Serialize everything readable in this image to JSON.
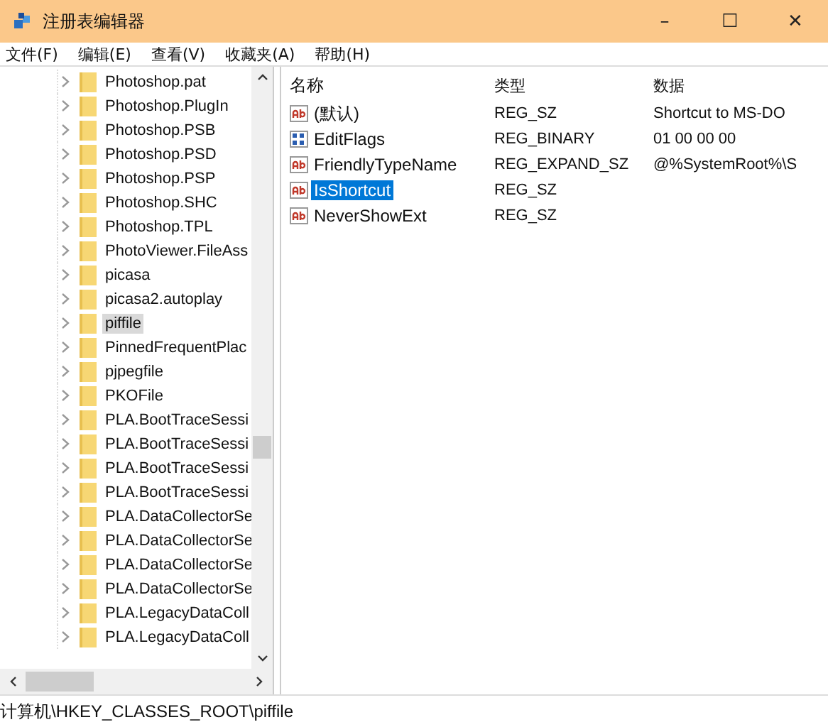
{
  "window": {
    "title": "注册表编辑器",
    "controls": [
      "–",
      "☐",
      "✕"
    ]
  },
  "menu": [
    "文件(F)",
    "编辑(E)",
    "查看(V)",
    "收藏夹(A)",
    "帮助(H)"
  ],
  "tree": [
    {
      "label": "Photoshop.pat",
      "selected": false
    },
    {
      "label": "Photoshop.PlugIn",
      "selected": false
    },
    {
      "label": "Photoshop.PSB",
      "selected": false
    },
    {
      "label": "Photoshop.PSD",
      "selected": false
    },
    {
      "label": "Photoshop.PSP",
      "selected": false
    },
    {
      "label": "Photoshop.SHC",
      "selected": false
    },
    {
      "label": "Photoshop.TPL",
      "selected": false
    },
    {
      "label": "PhotoViewer.FileAss",
      "selected": false
    },
    {
      "label": "picasa",
      "selected": false
    },
    {
      "label": "picasa2.autoplay",
      "selected": false
    },
    {
      "label": "piffile",
      "selected": true
    },
    {
      "label": "PinnedFrequentPlac",
      "selected": false
    },
    {
      "label": "pjpegfile",
      "selected": false
    },
    {
      "label": "PKOFile",
      "selected": false
    },
    {
      "label": "PLA.BootTraceSessi",
      "selected": false
    },
    {
      "label": "PLA.BootTraceSessi",
      "selected": false
    },
    {
      "label": "PLA.BootTraceSessi",
      "selected": false
    },
    {
      "label": "PLA.BootTraceSessi",
      "selected": false
    },
    {
      "label": "PLA.DataCollectorSe",
      "selected": false
    },
    {
      "label": "PLA.DataCollectorSe",
      "selected": false
    },
    {
      "label": "PLA.DataCollectorSe",
      "selected": false
    },
    {
      "label": "PLA.DataCollectorSe",
      "selected": false
    },
    {
      "label": "PLA.LegacyDataColl",
      "selected": false
    },
    {
      "label": "PLA.LegacyDataColl",
      "selected": false
    }
  ],
  "table": {
    "columns": [
      "名称",
      "类型",
      "数据"
    ],
    "rows": [
      {
        "kind": "string",
        "name": "(默认)",
        "type": "REG_SZ",
        "data": "Shortcut to MS-DO",
        "selected": false
      },
      {
        "kind": "binary",
        "name": "EditFlags",
        "type": "REG_BINARY",
        "data": "01 00 00 00",
        "selected": false
      },
      {
        "kind": "string",
        "name": "FriendlyTypeName",
        "type": "REG_EXPAND_SZ",
        "data": "@%SystemRoot%\\S",
        "selected": false
      },
      {
        "kind": "string",
        "name": "IsShortcut",
        "type": "REG_SZ",
        "selected": true
      },
      {
        "kind": "string",
        "name": "NeverShowExt",
        "type": "REG_SZ",
        "selected": false
      }
    ]
  },
  "status_bar": "计算机\\HKEY_CLASSES_ROOT\\piffile"
}
